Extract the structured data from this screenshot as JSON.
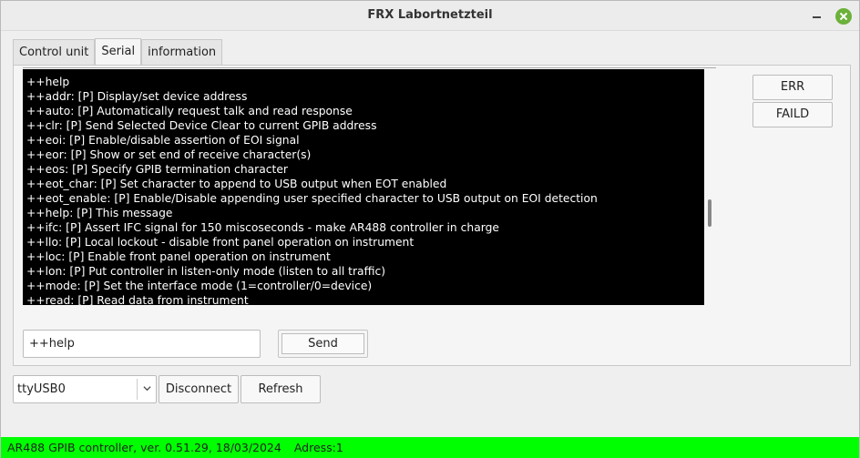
{
  "window": {
    "title": "FRX Labortnetzteil"
  },
  "tabs": [
    {
      "label": "Control unit"
    },
    {
      "label": "Serial"
    },
    {
      "label": "information"
    }
  ],
  "console": {
    "lines": [
      "++help",
      "++addr: [P] Display/set device address",
      "++auto: [P] Automatically request talk and read response",
      "++clr: [P] Send Selected Device Clear to current GPIB address",
      "++eoi: [P] Enable/disable assertion of EOI signal",
      "++eor: [P] Show or set end of receive character(s)",
      "++eos: [P] Specify GPIB termination character",
      "++eot_char: [P] Set character to append to USB output when EOT enabled",
      "++eot_enable: [P] Enable/Disable appending user specified character to USB output on EOI detection",
      "++help: [P] This message",
      "++ifc: [P] Assert IFC signal for 150 miscoseconds - make AR488 controller in charge",
      "++llo: [P] Local lockout - disable front panel operation on instrument",
      "++loc: [P] Enable front panel operation on instrument",
      "++lon: [P] Put controller in listen-only mode (listen to all traffic)",
      "++mode: [P] Set the interface mode (1=controller/0=device)",
      "++read: [P] Read data from instrument"
    ]
  },
  "side_buttons": {
    "err": "ERR",
    "faild": "FAILD"
  },
  "command": {
    "value": "++help",
    "send_label": "Send"
  },
  "connection": {
    "port": "ttyUSB0",
    "disconnect_label": "Disconnect",
    "refresh_label": "Refresh"
  },
  "status": {
    "device": "AR488 GPIB controller, ver. 0.51.29, 18/03/2024",
    "address": "Adress:1",
    "color": "#00ff00"
  }
}
